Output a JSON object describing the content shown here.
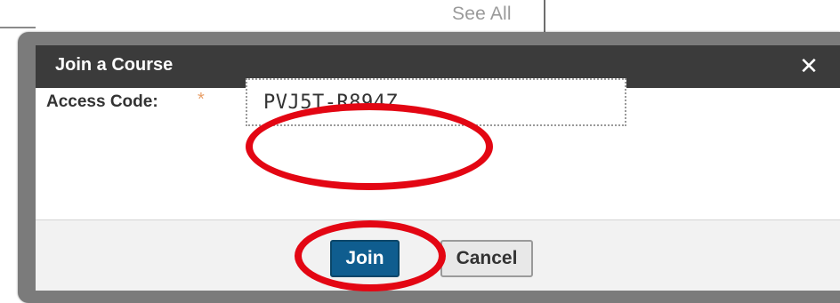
{
  "background": {
    "see_all_label": "See All"
  },
  "dialog": {
    "title": "Join a Course",
    "close_glyph": "✕",
    "access_code": {
      "label": "Access Code:",
      "required_marker": "*",
      "value": "PVJ5T-R894Z"
    },
    "buttons": {
      "join_label": "Join",
      "cancel_label": "Cancel"
    }
  },
  "annotations": {
    "color": "#e30613",
    "highlights": [
      "access-code-input",
      "join-button"
    ]
  },
  "colors": {
    "header_bg": "#3b3b3b",
    "primary_button": "#0f5d8f",
    "footer_bg": "#f2f2f2"
  }
}
